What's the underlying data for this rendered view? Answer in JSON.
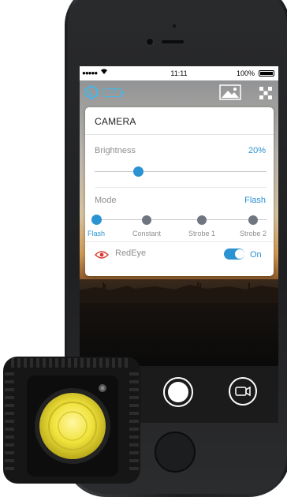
{
  "status_bar": {
    "signal": "●●●●●",
    "time": "11:11",
    "battery": "100%"
  },
  "toolbar": {
    "device_battery": "100",
    "logo_icon": "lume-cube-logo-icon",
    "gallery_icon": "image-gallery-icon",
    "devices_icon": "grid-dots-icon"
  },
  "camera_panel": {
    "title": "CAMERA",
    "brightness": {
      "label": "Brightness",
      "value": "20%",
      "level": 0.2
    },
    "mode": {
      "label": "Mode",
      "value": "Flash",
      "options": [
        "Flash",
        "Constant",
        "Strobe 1",
        "Strobe 2"
      ],
      "selected": 0
    },
    "redeye": {
      "label": "RedEye",
      "toggle_label": "On",
      "enabled": true
    }
  },
  "colors": {
    "accent": "#2b93d1",
    "redeye_icon": "#d8352f",
    "device_lens": "#f0e23a"
  }
}
